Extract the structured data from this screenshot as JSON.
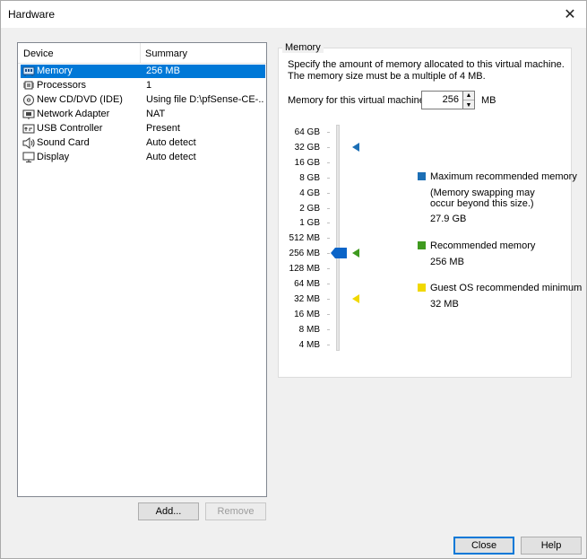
{
  "window": {
    "title": "Hardware",
    "close_glyph": "✕"
  },
  "device_list": {
    "columns": [
      "Device",
      "Summary"
    ],
    "rows": [
      {
        "icon": "memory-icon",
        "device": "Memory",
        "summary": "256 MB",
        "selected": true
      },
      {
        "icon": "processor-icon",
        "device": "Processors",
        "summary": "1",
        "selected": false
      },
      {
        "icon": "cd-dvd-icon",
        "device": "New CD/DVD (IDE)",
        "summary": "Using file D:\\pfSense-CE-...",
        "selected": false
      },
      {
        "icon": "network-adapter-icon",
        "device": "Network Adapter",
        "summary": "NAT",
        "selected": false
      },
      {
        "icon": "usb-controller-icon",
        "device": "USB Controller",
        "summary": "Present",
        "selected": false
      },
      {
        "icon": "sound-card-icon",
        "device": "Sound Card",
        "summary": "Auto detect",
        "selected": false
      },
      {
        "icon": "display-icon",
        "device": "Display",
        "summary": "Auto detect",
        "selected": false
      }
    ]
  },
  "buttons": {
    "add": "Add...",
    "remove": "Remove",
    "close": "Close",
    "help": "Help"
  },
  "memory": {
    "group_title": "Memory",
    "description": "Specify the amount of memory allocated to this virtual machine. The memory size must be a multiple of 4 MB.",
    "field_label": "Memory for this virtual machine:",
    "value": "256",
    "unit": "MB",
    "scale": [
      "64 GB",
      "32 GB",
      "16 GB",
      "8 GB",
      "4 GB",
      "2 GB",
      "1 GB",
      "512 MB",
      "256 MB",
      "128 MB",
      "64 MB",
      "32 MB",
      "16 MB",
      "8 MB",
      "4 MB"
    ],
    "current_level": "256 MB",
    "markers": {
      "maximum": {
        "level": "32 GB",
        "color": "#1c6fb5"
      },
      "recommended": {
        "level": "256 MB",
        "color": "#3f9a1f"
      },
      "guest_min": {
        "level": "32 MB",
        "color": "#f1d800"
      }
    },
    "legend": {
      "max_title": "Maximum recommended memory",
      "max_note_1": "(Memory swapping may",
      "max_note_2": "occur beyond this size.)",
      "max_value": "27.9 GB",
      "rec_title": "Recommended memory",
      "rec_value": "256 MB",
      "min_title": "Guest OS recommended minimum",
      "min_value": "32 MB"
    }
  },
  "colors": {
    "selection": "#0078d7",
    "thumb": "#0a64c8"
  }
}
